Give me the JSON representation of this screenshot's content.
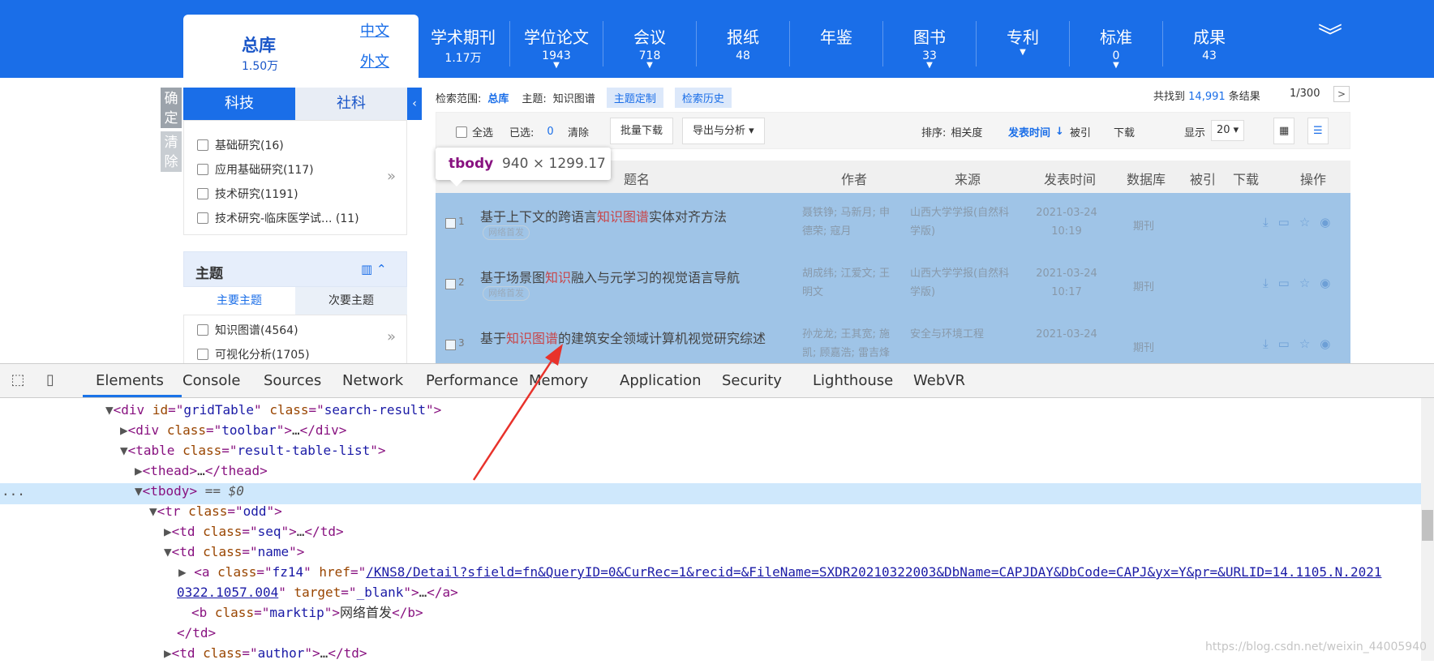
{
  "header": {
    "zongku": {
      "title": "总库",
      "count": "1.50万",
      "zh_label": "中文",
      "en_label": "外文"
    },
    "nav": [
      {
        "label": "学术期刊",
        "count": "1.17万",
        "caret": false
      },
      {
        "label": "学位论文",
        "count": "1943",
        "caret": true
      },
      {
        "label": "会议",
        "count": "718",
        "caret": true
      },
      {
        "label": "报纸",
        "count": "48",
        "caret": false
      },
      {
        "label": "年鉴",
        "count": "",
        "caret": false
      },
      {
        "label": "图书",
        "count": "33",
        "caret": true
      },
      {
        "label": "专利",
        "count": "",
        "caret": true
      },
      {
        "label": "标准",
        "count": "0",
        "caret": true
      },
      {
        "label": "成果",
        "count": "43",
        "caret": false
      }
    ],
    "more_icon": "double-chevron-down-icon"
  },
  "sidebar": {
    "confirm_label": "确定",
    "clear_label": "清除",
    "tabs": [
      "科技",
      "社科"
    ],
    "categories": [
      "基础研究(16)",
      "应用基础研究(117)",
      "技术研究(1191)",
      "技术研究-临床医学试...  (11)"
    ],
    "topic_title": "主题",
    "topic_subtabs": [
      "主要主题",
      "次要主题"
    ],
    "topics": [
      "知识图谱(4564)",
      "可视化分析(1705)"
    ]
  },
  "results": {
    "scope_label": "检索范围:",
    "scope_value": "总库",
    "theme_label": "主题:",
    "theme_value": "知识图谱",
    "theme_custom": "主题定制",
    "history": "检索历史",
    "found_prefix": "共找到",
    "found_count": "14,991",
    "found_suffix": "条结果",
    "page": "1/300",
    "next": ">",
    "toolbar": {
      "select_all": "全选",
      "selected_label": "已选:",
      "selected_count": "0",
      "clear": "清除",
      "batch_download": "批量下载",
      "export": "导出与分析",
      "sort_label": "排序:",
      "sort_relevance": "相关度",
      "sort_date": "发表时间",
      "sort_cited": "被引",
      "sort_download": "下载",
      "display_label": "显示",
      "display_value": "20"
    },
    "tooltip_tag": "tbody",
    "tooltip_size": "940 × 1299.17",
    "headers": [
      "题名",
      "作者",
      "来源",
      "发表时间",
      "数据库",
      "被引",
      "下载",
      "操作"
    ],
    "rows": [
      {
        "seq": "1",
        "title_pre": "基于上下文的跨语言",
        "title_hl": "知识图谱",
        "title_post": "实体对齐方法",
        "tag": "网络首发",
        "author": "聂铁铮; 马新月; 申德荣; 寇月",
        "source": "山西大学学报(自然科学版)",
        "date": "2021-03-24",
        "time": "10:19",
        "db": "期刊"
      },
      {
        "seq": "2",
        "title_pre": "基于场景图",
        "title_hl": "知识",
        "title_post": "融入与元学习的视觉语言导航",
        "tag": "网络首发",
        "author": "胡成纬; 江爱文; 王明文",
        "source": "山西大学学报(自然科学版)",
        "date": "2021-03-24",
        "time": "10:17",
        "db": "期刊"
      },
      {
        "seq": "3",
        "title_pre": "基于",
        "title_hl": "知识图谱",
        "title_post": "的建筑安全领域计算机视觉研究综述",
        "tag": "",
        "author": "孙龙龙; 王其宽; 施凯; 顾嘉浩; 雷吉烽",
        "source": "安全与环境工程",
        "date": "2021-03-24",
        "time": "",
        "db": "期刊"
      }
    ]
  },
  "devtools": {
    "tabs": [
      "Elements",
      "Console",
      "Sources",
      "Network",
      "Performance",
      "Memory",
      "Application",
      "Security",
      "Lighthouse",
      "WebVR"
    ],
    "lines": [
      "<div id=\"gridTable\" class=\"search-result\">",
      "<div class=\"toolbar\">…</div>",
      "<table class=\"result-table-list\">",
      "<thead>…</thead>",
      "<tbody> == $0",
      "<tr class=\"odd\">",
      "<td class=\"seq\">…</td>",
      "<td class=\"name\">",
      "<a class=\"fz14\" href=\"",
      "/KNS8/Detail?sfield=fn&QueryID=0&CurRec=1&recid=&FileName=SXDR20210322003&DbName=CAPJDAY&DbCode=CAPJ&yx=Y&pr=&URLID=14.1105.N.2021",
      "0322.1057.004",
      "\" target=\"_blank\">…</a>",
      "<b class=\"marktip\">网络首发</b>",
      "</td>",
      "<td class=\"author\">…</td>"
    ],
    "ellipsis": "..."
  },
  "watermark": "https://blog.csdn.net/weixin_44005940",
  "colors": {
    "brand": "#1a6ee8",
    "highlight": "#9fc4e7",
    "keyword": "#c7464a"
  }
}
